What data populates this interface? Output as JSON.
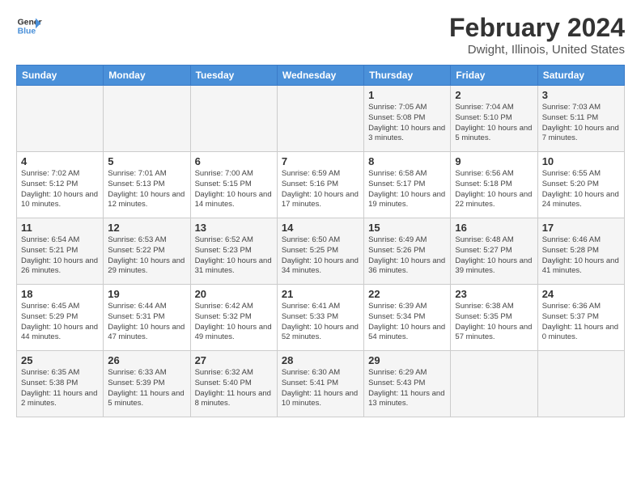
{
  "header": {
    "logo_line1": "General",
    "logo_line2": "Blue",
    "title": "February 2024",
    "subtitle": "Dwight, Illinois, United States"
  },
  "days_of_week": [
    "Sunday",
    "Monday",
    "Tuesday",
    "Wednesday",
    "Thursday",
    "Friday",
    "Saturday"
  ],
  "weeks": [
    [
      {
        "num": "",
        "info": ""
      },
      {
        "num": "",
        "info": ""
      },
      {
        "num": "",
        "info": ""
      },
      {
        "num": "",
        "info": ""
      },
      {
        "num": "1",
        "info": "Sunrise: 7:05 AM\nSunset: 5:08 PM\nDaylight: 10 hours\nand 3 minutes."
      },
      {
        "num": "2",
        "info": "Sunrise: 7:04 AM\nSunset: 5:10 PM\nDaylight: 10 hours\nand 5 minutes."
      },
      {
        "num": "3",
        "info": "Sunrise: 7:03 AM\nSunset: 5:11 PM\nDaylight: 10 hours\nand 7 minutes."
      }
    ],
    [
      {
        "num": "4",
        "info": "Sunrise: 7:02 AM\nSunset: 5:12 PM\nDaylight: 10 hours\nand 10 minutes."
      },
      {
        "num": "5",
        "info": "Sunrise: 7:01 AM\nSunset: 5:13 PM\nDaylight: 10 hours\nand 12 minutes."
      },
      {
        "num": "6",
        "info": "Sunrise: 7:00 AM\nSunset: 5:15 PM\nDaylight: 10 hours\nand 14 minutes."
      },
      {
        "num": "7",
        "info": "Sunrise: 6:59 AM\nSunset: 5:16 PM\nDaylight: 10 hours\nand 17 minutes."
      },
      {
        "num": "8",
        "info": "Sunrise: 6:58 AM\nSunset: 5:17 PM\nDaylight: 10 hours\nand 19 minutes."
      },
      {
        "num": "9",
        "info": "Sunrise: 6:56 AM\nSunset: 5:18 PM\nDaylight: 10 hours\nand 22 minutes."
      },
      {
        "num": "10",
        "info": "Sunrise: 6:55 AM\nSunset: 5:20 PM\nDaylight: 10 hours\nand 24 minutes."
      }
    ],
    [
      {
        "num": "11",
        "info": "Sunrise: 6:54 AM\nSunset: 5:21 PM\nDaylight: 10 hours\nand 26 minutes."
      },
      {
        "num": "12",
        "info": "Sunrise: 6:53 AM\nSunset: 5:22 PM\nDaylight: 10 hours\nand 29 minutes."
      },
      {
        "num": "13",
        "info": "Sunrise: 6:52 AM\nSunset: 5:23 PM\nDaylight: 10 hours\nand 31 minutes."
      },
      {
        "num": "14",
        "info": "Sunrise: 6:50 AM\nSunset: 5:25 PM\nDaylight: 10 hours\nand 34 minutes."
      },
      {
        "num": "15",
        "info": "Sunrise: 6:49 AM\nSunset: 5:26 PM\nDaylight: 10 hours\nand 36 minutes."
      },
      {
        "num": "16",
        "info": "Sunrise: 6:48 AM\nSunset: 5:27 PM\nDaylight: 10 hours\nand 39 minutes."
      },
      {
        "num": "17",
        "info": "Sunrise: 6:46 AM\nSunset: 5:28 PM\nDaylight: 10 hours\nand 41 minutes."
      }
    ],
    [
      {
        "num": "18",
        "info": "Sunrise: 6:45 AM\nSunset: 5:29 PM\nDaylight: 10 hours\nand 44 minutes."
      },
      {
        "num": "19",
        "info": "Sunrise: 6:44 AM\nSunset: 5:31 PM\nDaylight: 10 hours\nand 47 minutes."
      },
      {
        "num": "20",
        "info": "Sunrise: 6:42 AM\nSunset: 5:32 PM\nDaylight: 10 hours\nand 49 minutes."
      },
      {
        "num": "21",
        "info": "Sunrise: 6:41 AM\nSunset: 5:33 PM\nDaylight: 10 hours\nand 52 minutes."
      },
      {
        "num": "22",
        "info": "Sunrise: 6:39 AM\nSunset: 5:34 PM\nDaylight: 10 hours\nand 54 minutes."
      },
      {
        "num": "23",
        "info": "Sunrise: 6:38 AM\nSunset: 5:35 PM\nDaylight: 10 hours\nand 57 minutes."
      },
      {
        "num": "24",
        "info": "Sunrise: 6:36 AM\nSunset: 5:37 PM\nDaylight: 11 hours\nand 0 minutes."
      }
    ],
    [
      {
        "num": "25",
        "info": "Sunrise: 6:35 AM\nSunset: 5:38 PM\nDaylight: 11 hours\nand 2 minutes."
      },
      {
        "num": "26",
        "info": "Sunrise: 6:33 AM\nSunset: 5:39 PM\nDaylight: 11 hours\nand 5 minutes."
      },
      {
        "num": "27",
        "info": "Sunrise: 6:32 AM\nSunset: 5:40 PM\nDaylight: 11 hours\nand 8 minutes."
      },
      {
        "num": "28",
        "info": "Sunrise: 6:30 AM\nSunset: 5:41 PM\nDaylight: 11 hours\nand 10 minutes."
      },
      {
        "num": "29",
        "info": "Sunrise: 6:29 AM\nSunset: 5:43 PM\nDaylight: 11 hours\nand 13 minutes."
      },
      {
        "num": "",
        "info": ""
      },
      {
        "num": "",
        "info": ""
      }
    ]
  ]
}
